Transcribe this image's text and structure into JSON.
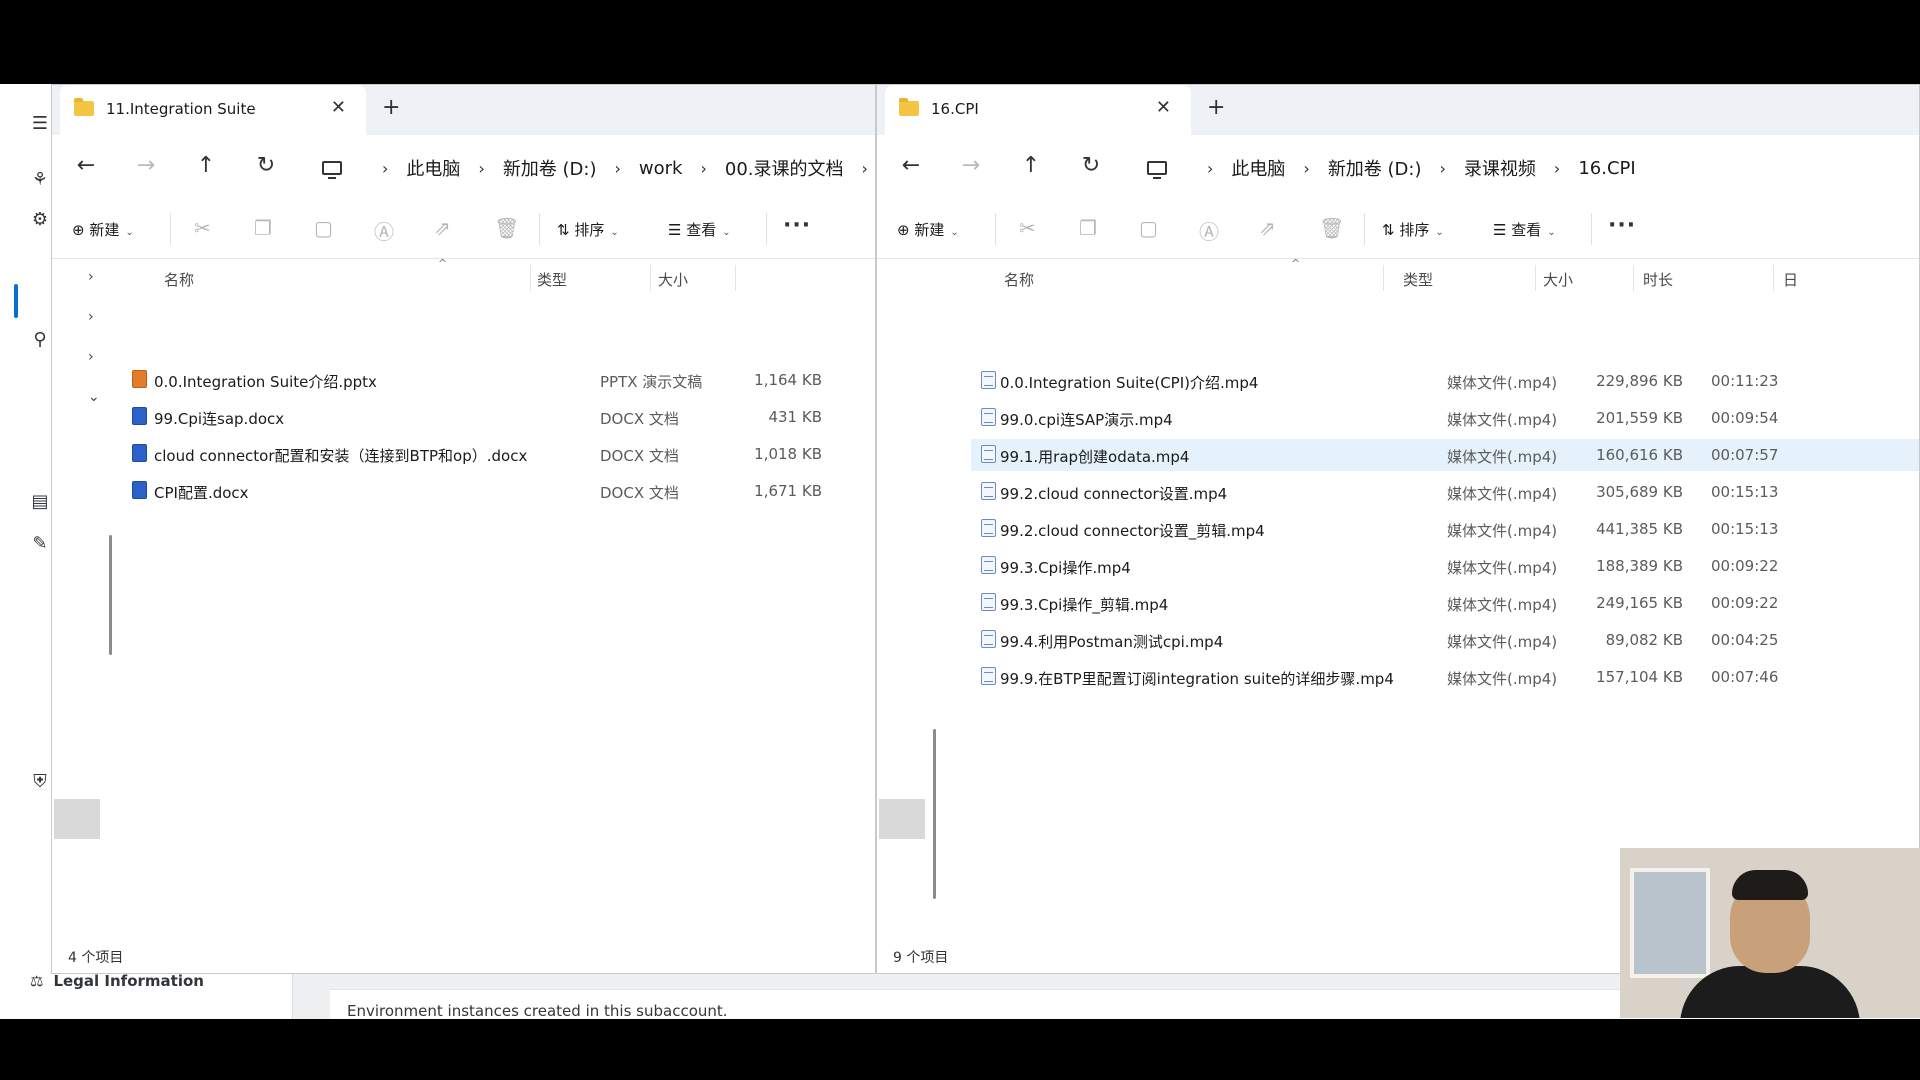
{
  "background": {
    "legal_label": "Legal Information",
    "footer_text": "Environment instances created in this subaccount."
  },
  "win1": {
    "tab_title": "11.Integration Suite",
    "crumbs": [
      "此电脑",
      "新加卷 (D:)",
      "work",
      "00.录课的文档"
    ],
    "cmd": {
      "new": "新建",
      "sort": "排序",
      "view": "查看"
    },
    "columns": {
      "name": "名称",
      "type": "类型",
      "size": "大小"
    },
    "files": [
      {
        "name": "0.0.Integration Suite介绍.pptx",
        "type": "PPTX 演示文稿",
        "size": "1,164 KB",
        "icon": "ppt"
      },
      {
        "name": "99.Cpi连sap.docx",
        "type": "DOCX 文档",
        "size": "431 KB",
        "icon": "doc"
      },
      {
        "name": "cloud connector配置和安装（连接到BTP和op）.docx",
        "type": "DOCX 文档",
        "size": "1,018 KB",
        "icon": "doc"
      },
      {
        "name": "CPI配置.docx",
        "type": "DOCX 文档",
        "size": "1,671 KB",
        "icon": "doc"
      }
    ],
    "status": "4 个项目"
  },
  "win2": {
    "tab_title": "16.CPI",
    "crumbs": [
      "此电脑",
      "新加卷 (D:)",
      "录课视频",
      "16.CPI"
    ],
    "cmd": {
      "new": "新建",
      "sort": "排序",
      "view": "查看"
    },
    "columns": {
      "name": "名称",
      "type": "类型",
      "size": "大小",
      "duration": "时长",
      "extra": "日"
    },
    "files": [
      {
        "name": "0.0.Integration Suite(CPI)介绍.mp4",
        "type": "媒体文件(.mp4)",
        "size": "229,896 KB",
        "duration": "00:11:23"
      },
      {
        "name": "99.0.cpi连SAP演示.mp4",
        "type": "媒体文件(.mp4)",
        "size": "201,559 KB",
        "duration": "00:09:54"
      },
      {
        "name": "99.1.用rap创建odata.mp4",
        "type": "媒体文件(.mp4)",
        "size": "160,616 KB",
        "duration": "00:07:57",
        "selected": true
      },
      {
        "name": "99.2.cloud connector设置.mp4",
        "type": "媒体文件(.mp4)",
        "size": "305,689 KB",
        "duration": "00:15:13"
      },
      {
        "name": "99.2.cloud connector设置_剪辑.mp4",
        "type": "媒体文件(.mp4)",
        "size": "441,385 KB",
        "duration": "00:15:13"
      },
      {
        "name": "99.3.Cpi操作.mp4",
        "type": "媒体文件(.mp4)",
        "size": "188,389 KB",
        "duration": "00:09:22"
      },
      {
        "name": "99.3.Cpi操作_剪辑.mp4",
        "type": "媒体文件(.mp4)",
        "size": "249,165 KB",
        "duration": "00:09:22"
      },
      {
        "name": "99.4.利用Postman测试cpi.mp4",
        "type": "媒体文件(.mp4)",
        "size": "89,082 KB",
        "duration": "00:04:25"
      },
      {
        "name": "99.9.在BTP里配置订阅integration suite的详细步骤.mp4",
        "type": "媒体文件(.mp4)",
        "size": "157,104 KB",
        "duration": "00:07:46"
      }
    ],
    "status": "9 个项目"
  }
}
